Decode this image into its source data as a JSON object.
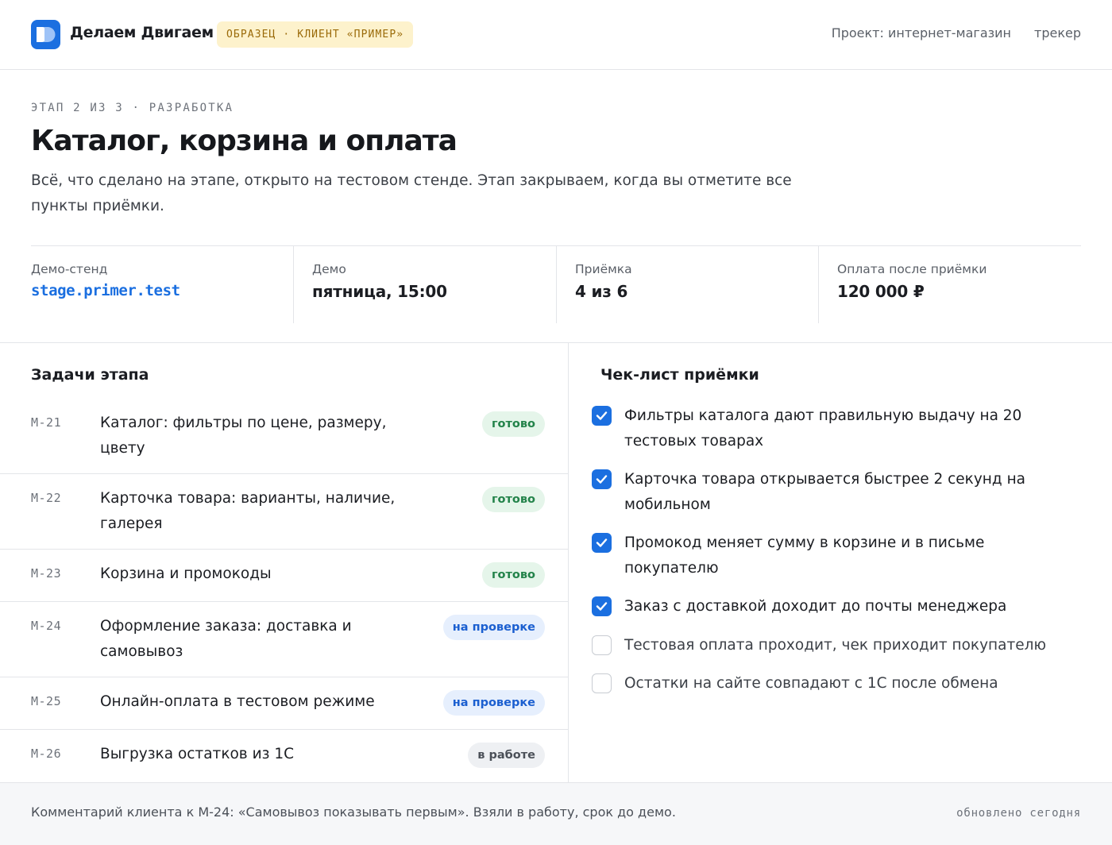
{
  "header": {
    "brand": "Делаем Двигаем",
    "sample_badge": "ОБРАЗЕЦ · КЛИЕНТ «ПРИМЕР»",
    "project": "Проект: интернет-магазин",
    "tracker": "трекер",
    "logo_icon": "brand-logo-icon",
    "brand_color": "#1b6fe0"
  },
  "stage": {
    "eyebrow": "ЭТАП 2 ИЗ 3 · РАЗРАБОТКА",
    "title": "Каталог, корзина и оплата",
    "lead": "Всё, что сделано на этапе, открыто на тестовом стенде. Этап закрываем, когда вы отметите все пункты приёмки."
  },
  "stats": [
    {
      "label": "Демо-стенд",
      "value": "stage.primer.test"
    },
    {
      "label": "Демо",
      "value": "пятница, 15:00"
    },
    {
      "label": "Приёмка",
      "value": "4 из 6"
    },
    {
      "label": "Оплата после приёмки",
      "value": "120 000 ₽"
    }
  ],
  "tasks": {
    "title": "Задачи этапа",
    "items": [
      {
        "id": "M-21",
        "name": "Каталог: фильтры по цене, размеру, цвету",
        "status": "готово",
        "status_kind": "done"
      },
      {
        "id": "M-22",
        "name": "Карточка товара: варианты, наличие, галерея",
        "status": "готово",
        "status_kind": "done"
      },
      {
        "id": "M-23",
        "name": "Корзина и промокоды",
        "status": "готово",
        "status_kind": "done"
      },
      {
        "id": "M-24",
        "name": "Оформление заказа: доставка и самовывоз",
        "status": "на проверке",
        "status_kind": "review"
      },
      {
        "id": "M-25",
        "name": "Онлайн-оплата в тестовом режиме",
        "status": "на проверке",
        "status_kind": "review"
      },
      {
        "id": "M-26",
        "name": "Выгрузка остатков из 1С",
        "status": "в работе",
        "status_kind": "work"
      }
    ]
  },
  "checklist": {
    "title": "Чек-лист приёмки",
    "items": [
      {
        "text": "Фильтры каталога дают правильную выдачу на 20 тестовых товарах",
        "checked": true
      },
      {
        "text": "Карточка товара открывается быстрее 2 секунд на мобильном",
        "checked": true
      },
      {
        "text": "Промокод меняет сумму в корзине и в письме покупателю",
        "checked": true
      },
      {
        "text": "Заказ с доставкой доходит до почты менеджера",
        "checked": true
      },
      {
        "text": "Тестовая оплата проходит, чек приходит покупателю",
        "checked": false
      },
      {
        "text": "Остатки на сайте совпадают с 1С после обмена",
        "checked": false
      }
    ]
  },
  "footer": {
    "comment": "Комментарий клиента к М-24: «Самовывоз показывать первым». Взяли в работу, срок до демо.",
    "updated": "обновлено сегодня"
  }
}
